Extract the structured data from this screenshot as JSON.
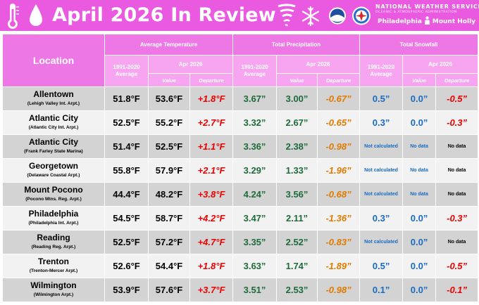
{
  "header": {
    "title": "April 2026 In Review",
    "nws_name": "NATIONAL WEATHER SERVICE",
    "nws_sub": "OCEANIC & ATMOSPHERIC ADMINISTRATION",
    "office_left": "Philadelphia",
    "office_right": "Mount Holly",
    "banner_color": "#e95ae0"
  },
  "columns": {
    "location": "Location",
    "temp_group": "Average Temperature",
    "precip_group": "Total Precipitation",
    "snow_group": "Total Snowfall",
    "normal_line1": "1991-2020",
    "normal_line2": "Average",
    "month": "Apr 2026",
    "value": "Value",
    "departure": "Departure"
  },
  "rows": [
    {
      "name": "Allentown",
      "sub": "(Lehigh Valley Int. Arpt.)",
      "t_avg": "51.8°F",
      "t_val": "53.6°F",
      "t_dep": "+1.8°F",
      "p_avg": "3.67”",
      "p_val": "3.00”",
      "p_dep": "-0.67”",
      "s_avg": "0.5”",
      "s_val": "0.0”",
      "s_dep": "-0.5”"
    },
    {
      "name": "Atlantic City",
      "sub": "(Atlantic City Int. Arpt.)",
      "t_avg": "52.5°F",
      "t_val": "55.2°F",
      "t_dep": "+2.7°F",
      "p_avg": "3.32”",
      "p_val": "2.67”",
      "p_dep": "-0.65”",
      "s_avg": "0.3”",
      "s_val": "0.0”",
      "s_dep": "-0.3”"
    },
    {
      "name": "Atlantic City",
      "sub": "(Frank Farley State Marina)",
      "t_avg": "51.4°F",
      "t_val": "52.5°F",
      "t_dep": "+1.1°F",
      "p_avg": "3.36”",
      "p_val": "2.38”",
      "p_dep": "-0.98”",
      "s_avg": "Not calculated",
      "s_val": "No data",
      "s_dep": "No data"
    },
    {
      "name": "Georgetown",
      "sub": "(Delaware Coastal Arpt.)",
      "t_avg": "55.8°F",
      "t_val": "57.9°F",
      "t_dep": "+2.1°F",
      "p_avg": "3.29”",
      "p_val": "1.33”",
      "p_dep": "-1.96”",
      "s_avg": "Not calculated",
      "s_val": "No data",
      "s_dep": "No data"
    },
    {
      "name": "Mount Pocono",
      "sub": "(Pocono Mtns. Reg. Arpt.)",
      "t_avg": "44.4°F",
      "t_val": "48.2°F",
      "t_dep": "+3.8°F",
      "p_avg": "4.24”",
      "p_val": "3.56”",
      "p_dep": "-0.68”",
      "s_avg": "Not calculated",
      "s_val": "No data",
      "s_dep": "No data"
    },
    {
      "name": "Philadelphia",
      "sub": "(Philadelphia Int. Arpt.)",
      "t_avg": "54.5°F",
      "t_val": "58.7°F",
      "t_dep": "+4.2°F",
      "p_avg": "3.47”",
      "p_val": "2.11”",
      "p_dep": "-1.36”",
      "s_avg": "0.3”",
      "s_val": "0.0”",
      "s_dep": "-0.3”"
    },
    {
      "name": "Reading",
      "sub": "(Reading Reg. Arpt.)",
      "t_avg": "52.5°F",
      "t_val": "57.2°F",
      "t_dep": "+4.7°F",
      "p_avg": "3.35”",
      "p_val": "2.52”",
      "p_dep": "-0.83”",
      "s_avg": "Not calculated",
      "s_val": "0.0”",
      "s_dep": "No data"
    },
    {
      "name": "Trenton",
      "sub": "(Trenton-Mercer Arpt.)",
      "t_avg": "52.6°F",
      "t_val": "54.4°F",
      "t_dep": "+1.8°F",
      "p_avg": "3.63”",
      "p_val": "1.74”",
      "p_dep": "-1.89”",
      "s_avg": "0.5”",
      "s_val": "0.0”",
      "s_dep": "-0.5”"
    },
    {
      "name": "Wilmington",
      "sub": "(Wilmington Arpt.)",
      "t_avg": "53.9°F",
      "t_val": "57.6°F",
      "t_dep": "+3.7°F",
      "p_avg": "3.51”",
      "p_val": "2.53”",
      "p_dep": "-0.98”",
      "s_avg": "0.1”",
      "s_val": "0.0”",
      "s_dep": "-0.1”"
    }
  ],
  "icons": [
    "thermometer-icon",
    "water-drop-icon",
    "tornado-icon",
    "snowflake-icon",
    "noaa-logo",
    "nws-logo",
    "person-icon"
  ]
}
